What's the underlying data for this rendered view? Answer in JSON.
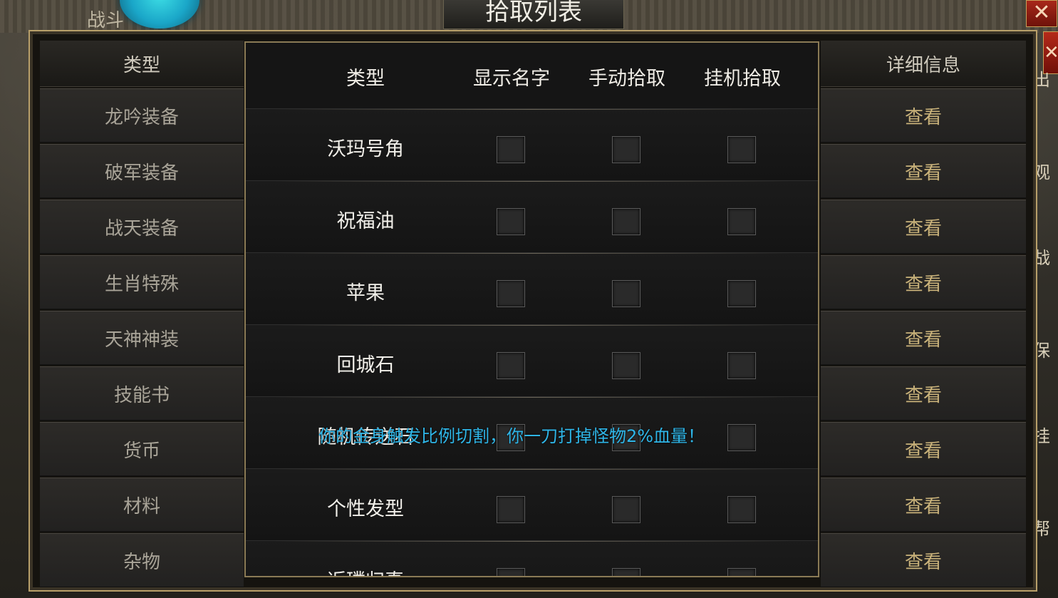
{
  "background": {
    "tab_text": "战斗"
  },
  "popup": {
    "title": "拾取列表",
    "close_icon": "close-icon",
    "headers": {
      "type": "类型",
      "show_name": "显示名字",
      "manual_pick": "手动拾取",
      "auto_pick": "挂机拾取"
    },
    "items": [
      {
        "label": "沃玛号角"
      },
      {
        "label": "祝福油"
      },
      {
        "label": "苹果"
      },
      {
        "label": "回城石"
      },
      {
        "label": "随机传送石"
      },
      {
        "label": "个性发型"
      },
      {
        "label": "返璞归真"
      }
    ]
  },
  "left_panel": {
    "header": "类型",
    "categories": [
      "龙吟装备",
      "破军装备",
      "战天装备",
      "生肖特殊",
      "天神神装",
      "技能书",
      "货币",
      "材料",
      "杂物"
    ]
  },
  "right_panel": {
    "header": "详细信息",
    "view_label": "查看"
  },
  "toast": "你的金身触发比例切割，你一刀打掉怪物2%血量！",
  "colors": {
    "frame_gold": "#b9a06a",
    "toast_cyan": "#2fb6e8",
    "view_gold": "#c9b27a",
    "close_red": "#a8281a"
  }
}
